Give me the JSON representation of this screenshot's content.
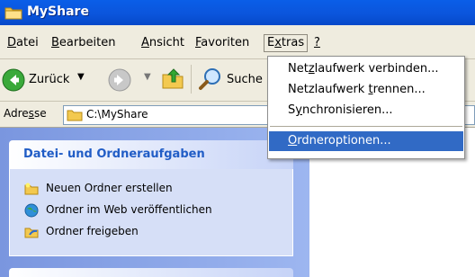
{
  "window": {
    "title": "MyShare"
  },
  "menubar": {
    "items": [
      {
        "pre": "",
        "u": "D",
        "post": "atei"
      },
      {
        "pre": "",
        "u": "B",
        "post": "earbeiten"
      },
      {
        "pre": "",
        "u": "A",
        "post": "nsicht"
      },
      {
        "pre": "",
        "u": "F",
        "post": "avoriten"
      },
      {
        "pre": "E",
        "u": "x",
        "post": "tras"
      },
      {
        "pre": "",
        "u": "?",
        "post": ""
      }
    ]
  },
  "toolbar": {
    "back_label": "Zurück",
    "search_label": "Suche"
  },
  "address": {
    "label_pre": "Adre",
    "label_u": "s",
    "label_post": "se",
    "value": "C:\\MyShare"
  },
  "tasks_panel": {
    "title": "Datei- und Ordneraufgaben",
    "tasks": [
      {
        "label": "Neuen Ordner erstellen",
        "icon": "new-folder-icon"
      },
      {
        "label": "Ordner im Web veröffentlichen",
        "icon": "publish-web-icon"
      },
      {
        "label": "Ordner freigeben",
        "icon": "share-folder-icon"
      }
    ]
  },
  "extras_menu": {
    "items": [
      {
        "pre": "Net",
        "u": "z",
        "post": "laufwerk verbinden..."
      },
      {
        "pre": "Netzlaufwerk ",
        "u": "t",
        "post": "rennen..."
      },
      {
        "pre": "S",
        "u": "y",
        "post": "nchronisieren..."
      },
      {
        "pre": "",
        "u": "O",
        "post": "rdneroptionen..."
      }
    ]
  },
  "colors": {
    "titlebar": "#0b55dc",
    "menu_highlight": "#316ac5",
    "panel_title": "#215dc6",
    "chrome": "#efecdf"
  }
}
